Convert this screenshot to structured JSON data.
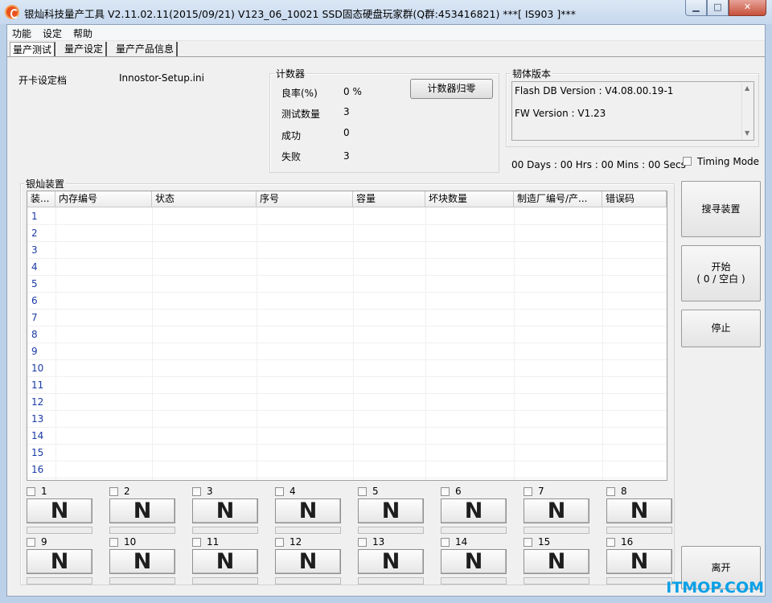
{
  "window": {
    "title": "银灿科技量产工具 V2.11.02.11(2015/09/21) V123_06_10021     SSD固态硬盘玩家群(Q群:453416821)     ***[ IS903 ]***",
    "minimize": "▁",
    "maximize": "□",
    "close": "✕"
  },
  "menu": [
    "功能",
    "设定",
    "帮助"
  ],
  "tabs": [
    "量产测试",
    "量产设定",
    "量产产品信息"
  ],
  "settings": {
    "label": "开卡设定档",
    "value": "Innostor-Setup.ini"
  },
  "counter": {
    "title": "计数器",
    "rows": [
      {
        "label": "良率(%)",
        "value": "0 %"
      },
      {
        "label": "测试数量",
        "value": "3"
      },
      {
        "label": "成功",
        "value": "0"
      },
      {
        "label": "失败",
        "value": "3"
      }
    ],
    "reset_button": "计数器归零"
  },
  "firmware": {
    "title": "韧体版本",
    "flash_db": "Flash DB Version :  V4.08.00.19-1",
    "fw": "FW Version :   V1.23"
  },
  "timer": "00 Days : 00 Hrs : 00 Mins : 00 Secs",
  "timing_mode": {
    "label": "Timing Mode",
    "checked": false
  },
  "devices": {
    "title": "银灿装置",
    "columns": [
      "装...",
      "内存编号",
      "状态",
      "序号",
      "容量",
      "坏块数量",
      "制造厂编号/产...",
      "错误码"
    ],
    "rows": [
      "1",
      "2",
      "3",
      "4",
      "5",
      "6",
      "7",
      "8",
      "9",
      "10",
      "11",
      "12",
      "13",
      "14",
      "15",
      "16"
    ]
  },
  "ports": [
    {
      "num": "1",
      "status": "N"
    },
    {
      "num": "2",
      "status": "N"
    },
    {
      "num": "3",
      "status": "N"
    },
    {
      "num": "4",
      "status": "N"
    },
    {
      "num": "5",
      "status": "N"
    },
    {
      "num": "6",
      "status": "N"
    },
    {
      "num": "7",
      "status": "N"
    },
    {
      "num": "8",
      "status": "N"
    },
    {
      "num": "9",
      "status": "N"
    },
    {
      "num": "10",
      "status": "N"
    },
    {
      "num": "11",
      "status": "N"
    },
    {
      "num": "12",
      "status": "N"
    },
    {
      "num": "13",
      "status": "N"
    },
    {
      "num": "14",
      "status": "N"
    },
    {
      "num": "15",
      "status": "N"
    },
    {
      "num": "16",
      "status": "N"
    }
  ],
  "side_buttons": {
    "scan": "搜寻装置",
    "start_line1": "开始",
    "start_line2": "( 0 / 空白 )",
    "stop": "停止",
    "exit": "离开"
  },
  "watermark": "ITMOP.COM"
}
